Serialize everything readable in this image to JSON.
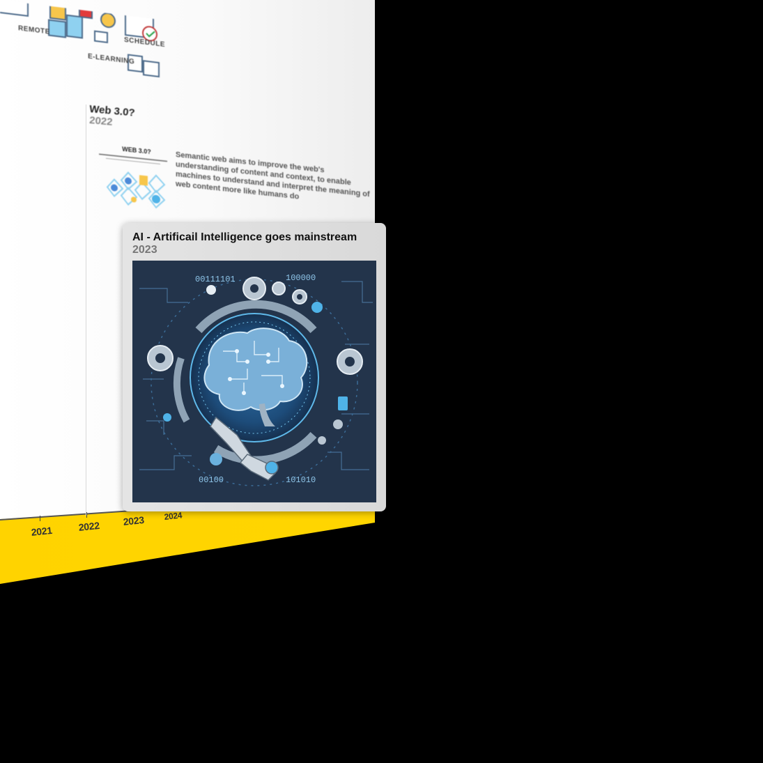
{
  "timeline": {
    "axis_years": [
      "2021",
      "2022",
      "2023",
      "2024"
    ],
    "upper_item": {
      "labels": [
        "REMOTE",
        "SCHEDULE",
        "E-LEARNING"
      ]
    },
    "web3_item": {
      "title": "Web 3.0?",
      "year": "2022",
      "image_caption": "WEB 3.0?",
      "description": "Semantic web aims to improve the web's understanding of content and context, to enable machines to understand and interpret the meaning of web content more like humans do"
    }
  },
  "card": {
    "title": "AI - Artificail Intelligence goes mainstream",
    "year": "2023",
    "image": {
      "alt_icon": "ai-brain-illustration",
      "binary_labels": [
        "00111101",
        "100000",
        "00100",
        "101010"
      ]
    }
  },
  "colors": {
    "floor": "#ffd300",
    "card_bg": "#dedede",
    "image_bg": "#24344a",
    "accent_blue": "#4fb3e8"
  }
}
